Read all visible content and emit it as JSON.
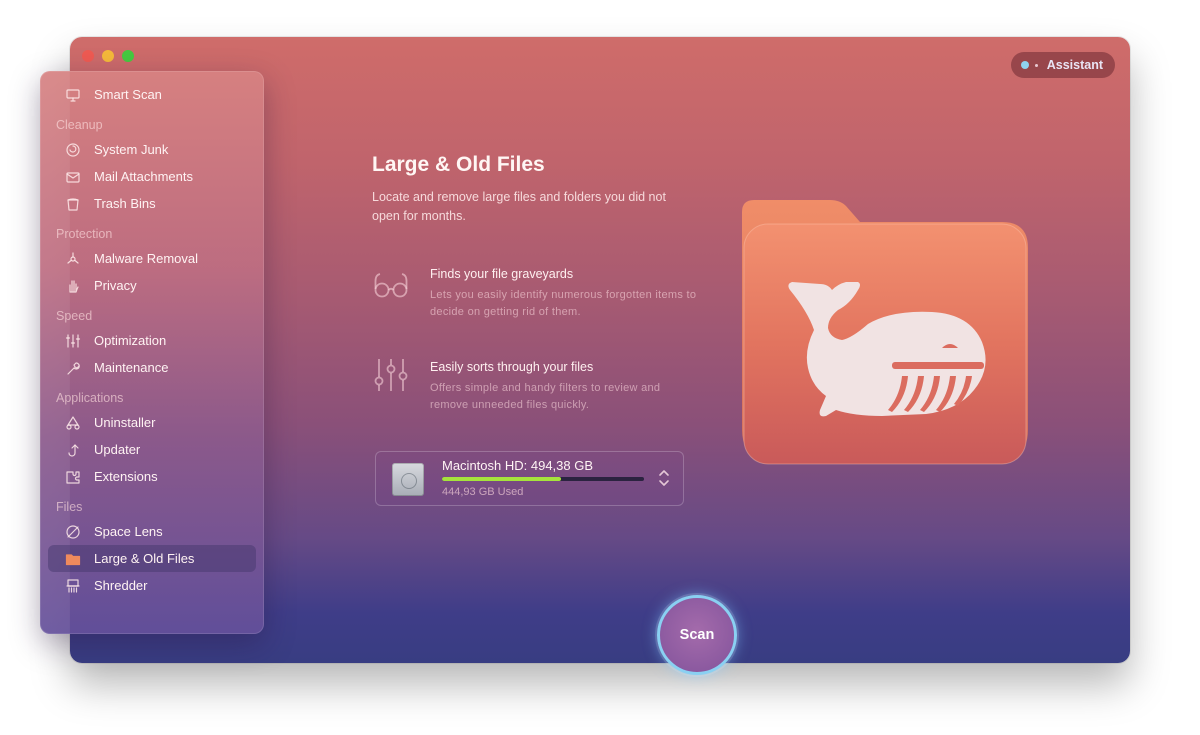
{
  "window": {
    "traffic_lights": [
      "close",
      "minimize",
      "zoom"
    ],
    "assistant_label": "Assistant"
  },
  "sidebar": {
    "items": [
      {
        "type": "item",
        "label": "Smart Scan",
        "icon": "monitor-icon"
      },
      {
        "type": "section",
        "label": "Cleanup"
      },
      {
        "type": "item",
        "label": "System Junk",
        "icon": "swirl-icon"
      },
      {
        "type": "item",
        "label": "Mail Attachments",
        "icon": "envelope-icon"
      },
      {
        "type": "item",
        "label": "Trash Bins",
        "icon": "trash-icon"
      },
      {
        "type": "section",
        "label": "Protection"
      },
      {
        "type": "item",
        "label": "Malware Removal",
        "icon": "biohazard-icon"
      },
      {
        "type": "item",
        "label": "Privacy",
        "icon": "hand-icon"
      },
      {
        "type": "section",
        "label": "Speed"
      },
      {
        "type": "item",
        "label": "Optimization",
        "icon": "sliders-icon"
      },
      {
        "type": "item",
        "label": "Maintenance",
        "icon": "wrench-icon"
      },
      {
        "type": "section",
        "label": "Applications"
      },
      {
        "type": "item",
        "label": "Uninstaller",
        "icon": "uninstaller-icon"
      },
      {
        "type": "item",
        "label": "Updater",
        "icon": "updater-icon"
      },
      {
        "type": "item",
        "label": "Extensions",
        "icon": "puzzle-icon"
      },
      {
        "type": "section",
        "label": "Files"
      },
      {
        "type": "item",
        "label": "Space Lens",
        "icon": "lens-icon"
      },
      {
        "type": "item",
        "label": "Large & Old Files",
        "icon": "folder-icon",
        "active": true
      },
      {
        "type": "item",
        "label": "Shredder",
        "icon": "shredder-icon"
      }
    ]
  },
  "main": {
    "title": "Large & Old Files",
    "subtitle": "Locate and remove large files and folders you did not open for months.",
    "features": [
      {
        "icon": "glasses-icon",
        "title": "Finds your file graveyards",
        "description": "Lets you easily identify numerous forgotten items to decide on getting rid of them."
      },
      {
        "icon": "filters-icon",
        "title": "Easily sorts through your files",
        "description": "Offers simple and handy filters to review and remove unneeded files quickly."
      }
    ],
    "disk": {
      "name": "Macintosh HD: 494,38 GB",
      "used": "444,93 GB Used",
      "bar_fill_fraction": 0.59,
      "bar_color": "#a6e33c"
    },
    "scan_label": "Scan"
  },
  "colors": {
    "accent_scan_ring": "#8ad0f2",
    "folder_orange": "#ee8a66"
  }
}
